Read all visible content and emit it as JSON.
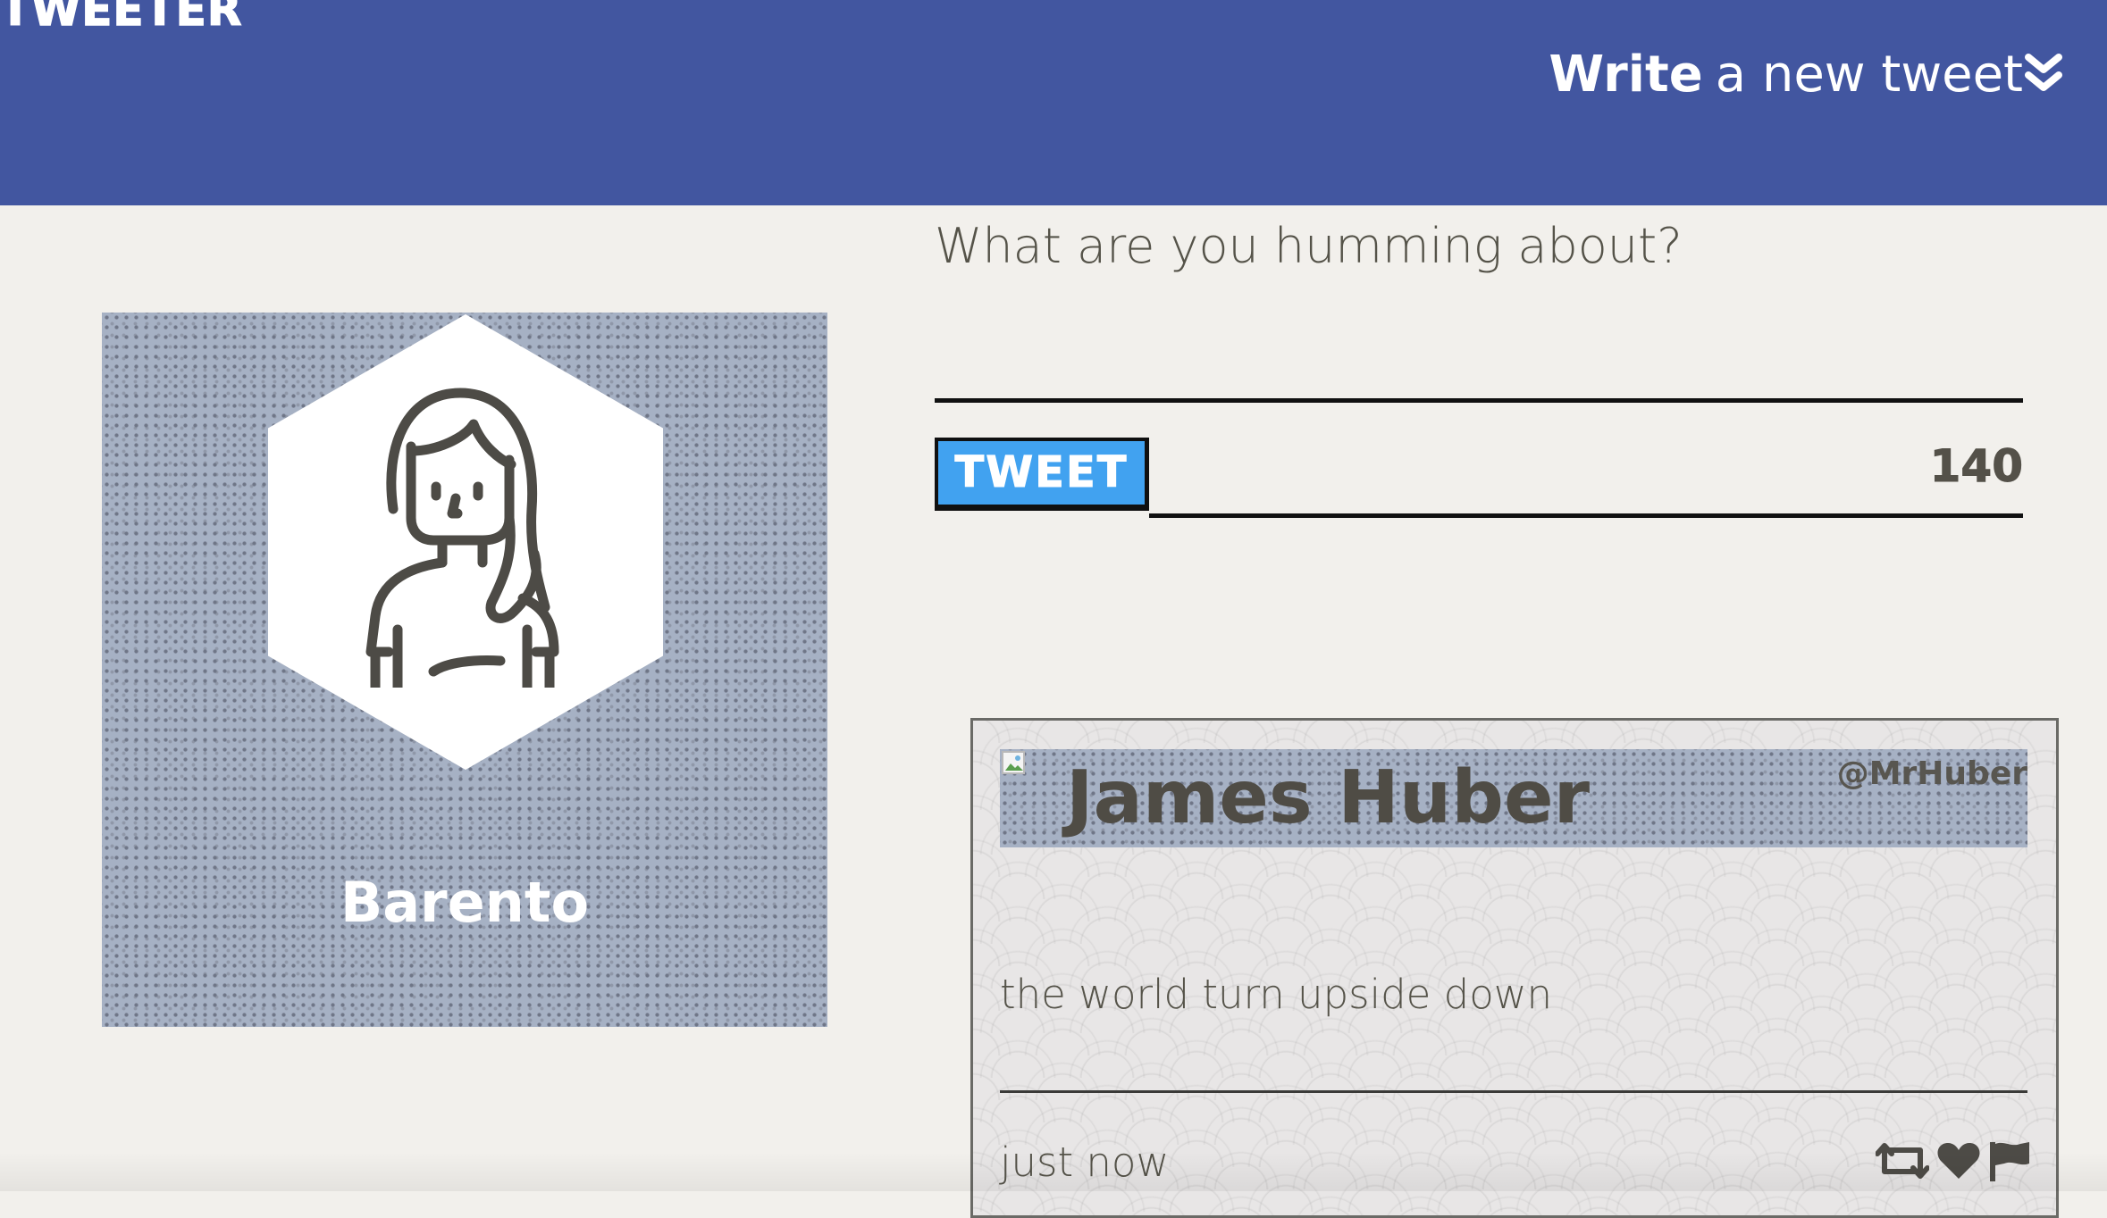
{
  "nav": {
    "brand": "TWEETER",
    "compose_toggle_strong": "Write",
    "compose_toggle_light": "a new tweet",
    "chevron_icon": "double-chevron-down-icon"
  },
  "profile": {
    "name": "Barento",
    "avatar_icon": "woman-avatar-icon"
  },
  "compose": {
    "placeholder": "What are you humming about?",
    "button_label": "TWEET",
    "counter": "140"
  },
  "tweet": {
    "author": "James Huber",
    "handle": "@MrHuber",
    "text": "the world turn upside down",
    "time": "just now",
    "actions": [
      "retweet-icon",
      "heart-icon",
      "flag-icon"
    ]
  },
  "colors": {
    "nav_bg": "#4256a0",
    "page_bg": "#f2f0ec",
    "tweet_button": "#41a2f0",
    "text": "#545149"
  }
}
